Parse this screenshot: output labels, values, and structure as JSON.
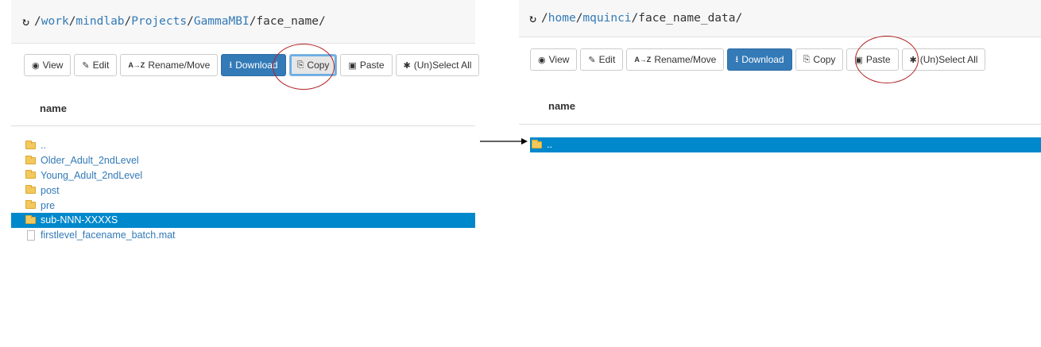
{
  "left": {
    "path": [
      "work",
      "mindlab",
      "Projects",
      "GammaMBI",
      "face_name"
    ],
    "toolbar": {
      "view": "View",
      "edit": "Edit",
      "rename": "Rename/Move",
      "download": "Download",
      "copy": "Copy",
      "paste": "Paste",
      "select_all": "(Un)Select All"
    },
    "column_header": "name",
    "items": [
      {
        "name": "..",
        "type": "folder"
      },
      {
        "name": "Older_Adult_2ndLevel",
        "type": "folder"
      },
      {
        "name": "Young_Adult_2ndLevel",
        "type": "folder"
      },
      {
        "name": "post",
        "type": "folder"
      },
      {
        "name": "pre",
        "type": "folder"
      },
      {
        "name": "sub-NNN-XXXXS",
        "type": "folder",
        "selected": true
      },
      {
        "name": "firstlevel_facename_batch.mat",
        "type": "file"
      }
    ]
  },
  "right": {
    "path": [
      "home",
      "mquinci",
      "face_name_data"
    ],
    "toolbar": {
      "view": "View",
      "edit": "Edit",
      "rename": "Rename/Move",
      "download": "Download",
      "copy": "Copy",
      "paste": "Paste",
      "select_all": "(Un)Select All"
    },
    "column_header": "name",
    "items": [
      {
        "name": "..",
        "type": "folder",
        "selected": true
      }
    ]
  },
  "icons": {
    "refresh": "refresh-icon",
    "view": "eye-icon",
    "edit": "edit-icon",
    "rename": "sort-alpha-icon",
    "download": "download-icon",
    "copy": "copy-icon",
    "paste": "paste-icon",
    "select_all": "asterisk-icon"
  },
  "colors": {
    "link": "#337ab7",
    "selected_row": "#0088cc",
    "primary_button": "#337ab7",
    "annotation_circle": "#b22222"
  }
}
